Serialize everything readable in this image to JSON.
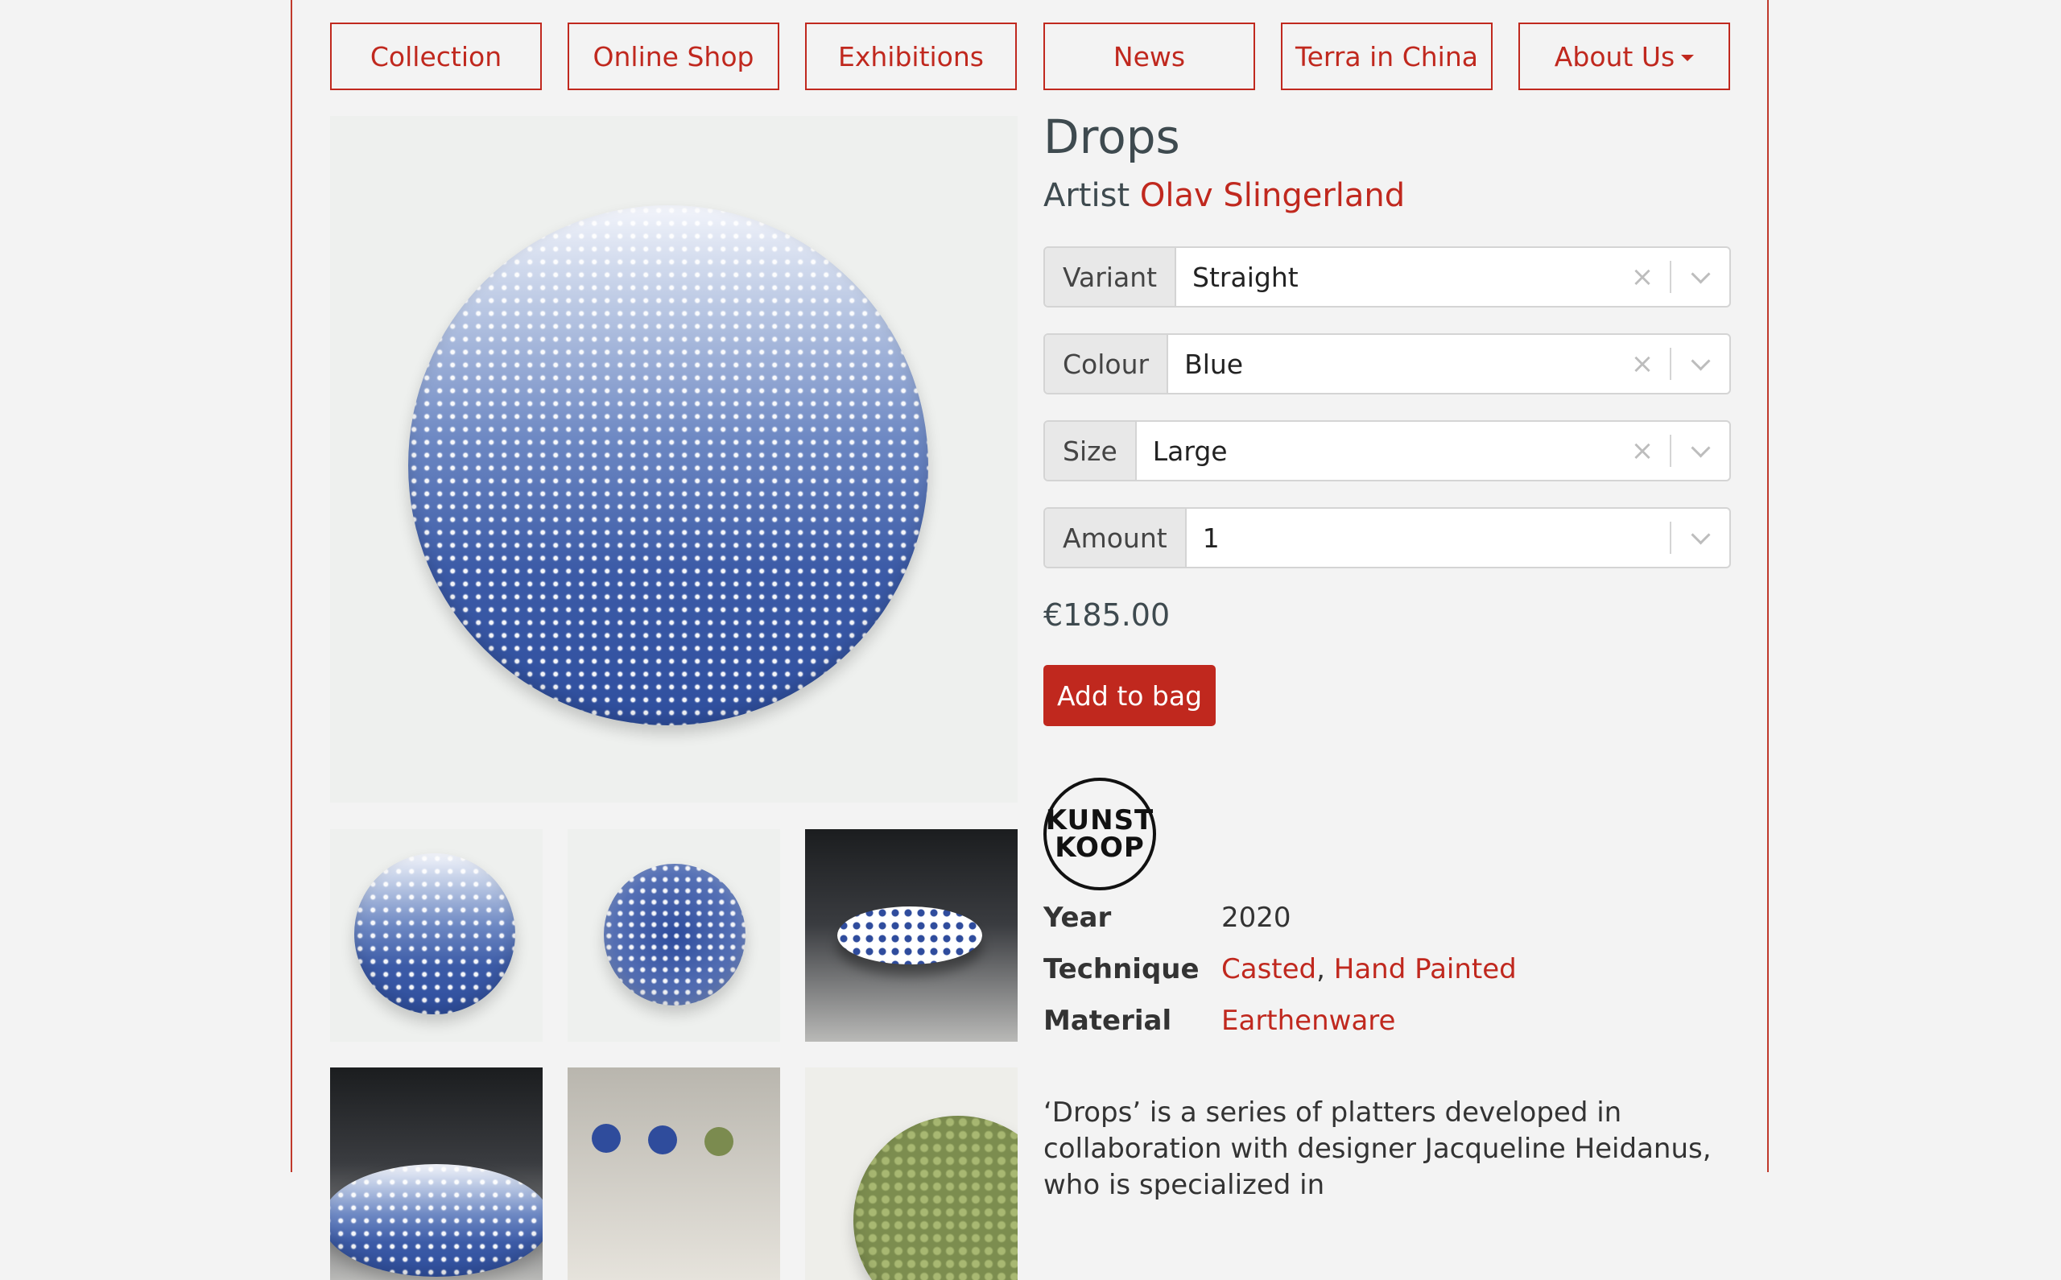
{
  "nav": {
    "collection": "Collection",
    "online_shop": "Online Shop",
    "exhibitions": "Exhibitions",
    "news": "News",
    "terra_in_china": "Terra in China",
    "about_us": "About Us"
  },
  "product": {
    "title": "Drops",
    "artist_prefix": "Artist",
    "artist_name": "Olav Slingerland",
    "price": "€185.00",
    "add_to_bag": "Add to bag",
    "logo_line1": "KUNST",
    "logo_line2": "KOOP"
  },
  "options": {
    "variant": {
      "label": "Variant",
      "value": "Straight"
    },
    "colour": {
      "label": "Colour",
      "value": "Blue"
    },
    "size": {
      "label": "Size",
      "value": "Large"
    },
    "amount": {
      "label": "Amount",
      "value": "1"
    }
  },
  "meta": {
    "year_label": "Year",
    "year_value": "2020",
    "technique_label": "Technique",
    "technique_1": "Casted",
    "technique_sep": ", ",
    "technique_2": "Hand Painted",
    "material_label": "Material",
    "material_value": "Earthenware"
  },
  "description": "‘Drops’ is a series of platters developed in collaboration with designer Jacqueline Heidanus, who is specialized in",
  "colors": {
    "accent": "#c0281e",
    "background": "#f3f3f3",
    "plate_blue": "#3d5fa8"
  },
  "icons": {
    "clear": "×",
    "dropdown": "chevron-down"
  }
}
